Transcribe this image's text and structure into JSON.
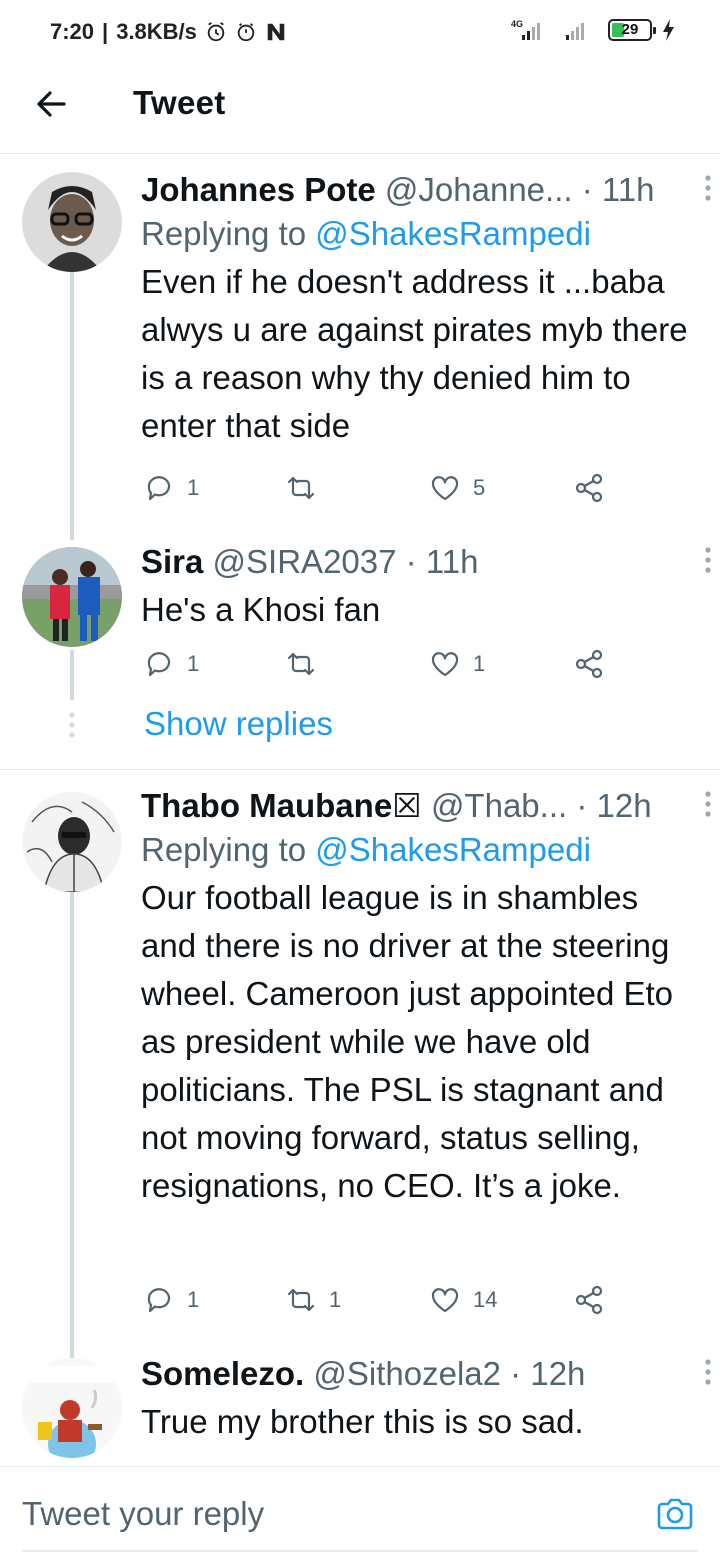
{
  "status_bar": {
    "time": "7:20",
    "speed": "3.8KB/s",
    "network": "4G",
    "battery": "29"
  },
  "header": {
    "title": "Tweet"
  },
  "tweets": [
    {
      "name": "Johannes Pote",
      "handle": "@Johanne...",
      "time": "11h",
      "replying_to_prefix": "Replying to",
      "replying_to": "@ShakesRampedi",
      "text": "Even if he doesn't  address it ...baba alwys u are against pirates myb there is a reason  why thy denied  him to enter that side",
      "replies": "1",
      "retweets": "",
      "likes": "5"
    },
    {
      "name": "Sira",
      "handle": "@SIRA2037",
      "time": "11h",
      "text": "He's a Khosi fan",
      "replies": "1",
      "retweets": "",
      "likes": "1"
    },
    {
      "name": "Thabo Maubane☒",
      "handle": "@Thab...",
      "time": "12h",
      "replying_to_prefix": "Replying to",
      "replying_to": "@ShakesRampedi",
      "text": "Our football league is in shambles and there is no driver at the steering wheel. Cameroon just appointed Eto as president while we have old politicians. The PSL is stagnant and not moving forward, status selling, resignations, no CEO. It’s a joke.",
      "replies": "1",
      "retweets": "1",
      "likes": "14"
    },
    {
      "name": "Somelezo.",
      "handle": "@Sithozela2",
      "time": "12h",
      "text": "True my brother this is so sad."
    }
  ],
  "show_replies": "Show replies",
  "reply_bar": {
    "placeholder": "Tweet your reply"
  },
  "colors": {
    "accent": "#1d9bf0",
    "muted": "#536471",
    "divider": "#e6ecf0"
  }
}
